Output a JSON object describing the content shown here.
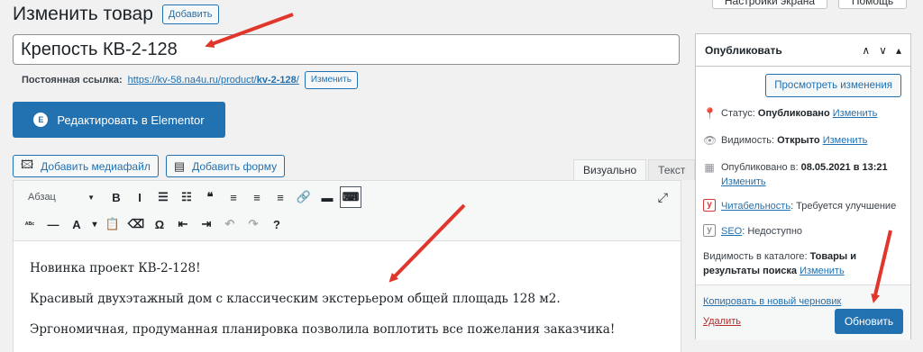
{
  "header": {
    "title": "Изменить товар",
    "add_label": "Добавить",
    "top_tabs": [
      "Настройки экрана",
      "Помощь"
    ]
  },
  "post": {
    "title_value": "Крепость КВ-2-128",
    "permalink_label": "Постоянная ссылка:",
    "permalink_base": "https://kv-58.na4u.ru/product/",
    "permalink_slug": "kv-2-128",
    "permalink_tail": "/",
    "permalink_edit": "Изменить"
  },
  "elementor": {
    "label": "Редактировать в Elementor",
    "icon": "elementor-icon"
  },
  "media": {
    "add_media": "Добавить медиафайл",
    "add_form": "Добавить форму"
  },
  "editor": {
    "tab_visual": "Визуально",
    "tab_text": "Текст",
    "format_select": "Абзац",
    "toolbar_row1": [
      {
        "name": "bold-icon",
        "glyph": "B"
      },
      {
        "name": "italic-icon",
        "glyph": "I"
      },
      {
        "name": "bullet-list-icon",
        "glyph": "☰"
      },
      {
        "name": "numbered-list-icon",
        "glyph": "☷"
      },
      {
        "name": "blockquote-icon",
        "glyph": "❝"
      },
      {
        "name": "align-left-icon",
        "glyph": "≡"
      },
      {
        "name": "align-center-icon",
        "glyph": "≡"
      },
      {
        "name": "align-right-icon",
        "glyph": "≡"
      },
      {
        "name": "link-icon",
        "glyph": "🔗"
      },
      {
        "name": "read-more-icon",
        "glyph": "▬"
      },
      {
        "name": "toolbar-toggle-icon",
        "glyph": "⌨"
      }
    ],
    "toolbar_row2": [
      {
        "name": "strikethrough-icon",
        "glyph": "ᴬᴮᶜ"
      },
      {
        "name": "horizontal-line-icon",
        "glyph": "—"
      },
      {
        "name": "text-color-icon",
        "glyph": "A"
      },
      {
        "name": "text-color-dropdown-icon",
        "glyph": "▾"
      },
      {
        "name": "paste-text-icon",
        "glyph": "📋"
      },
      {
        "name": "clear-formatting-icon",
        "glyph": "⌫"
      },
      {
        "name": "special-character-icon",
        "glyph": "Ω"
      },
      {
        "name": "outdent-icon",
        "glyph": "⇤"
      },
      {
        "name": "indent-icon",
        "glyph": "⇥"
      },
      {
        "name": "undo-icon",
        "glyph": "↶"
      },
      {
        "name": "redo-icon",
        "glyph": "↷"
      },
      {
        "name": "help-icon",
        "glyph": "?"
      }
    ],
    "paragraphs": [
      "Новинка проект КВ-2-128!",
      "Красивый двухэтажный дом с классическим экстерьером общей площадь 128 м2.",
      "Эргономичная, продуманная планировка позволила воплотить все пожелания заказчика!"
    ]
  },
  "publish": {
    "title": "Опубликовать",
    "preview": "Просмотреть изменения",
    "status_label": "Статус:",
    "status_value": "Опубликовано",
    "visibility_label": "Видимость:",
    "visibility_value": "Открыто",
    "published_label": "Опубликовано в:",
    "published_value": "08.05.2021 в 13:21",
    "readability_link": "Читабельность",
    "readability_value": ": Требуется улучшение",
    "seo_link": "SEO",
    "seo_value": ": Недоступно",
    "catalog_label": "Видимость в каталоге:",
    "catalog_value": "Товары и результаты поиска",
    "edit_link": "Изменить",
    "copy_draft": "Копировать в новый черновик",
    "delete": "Удалить",
    "update": "Обновить"
  },
  "colors": {
    "accent": "#2271b1",
    "annotation_arrow": "#e0362c",
    "delete": "#b32d2e"
  }
}
